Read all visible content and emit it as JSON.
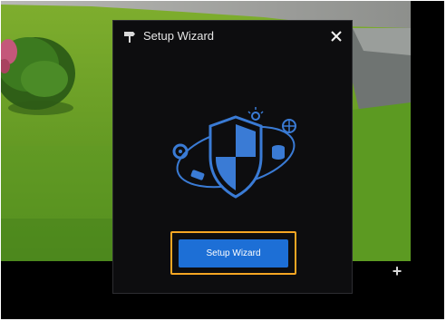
{
  "background": {
    "scene": "camera-live-view",
    "controls": {
      "add_icon": "plus-icon",
      "add_label": "+"
    }
  },
  "dialog": {
    "title": "Setup Wizard",
    "title_icon": "signpost-icon",
    "close_icon": "close-icon",
    "illustration_icon": "security-shield-icon",
    "primary_button_label": "Setup Wizard"
  },
  "colors": {
    "dialog_background": "#0d0d0f",
    "accent_blue": "#1d6fd6",
    "illustration_blue": "#3a7bd5",
    "highlight_orange": "#f5a623"
  }
}
